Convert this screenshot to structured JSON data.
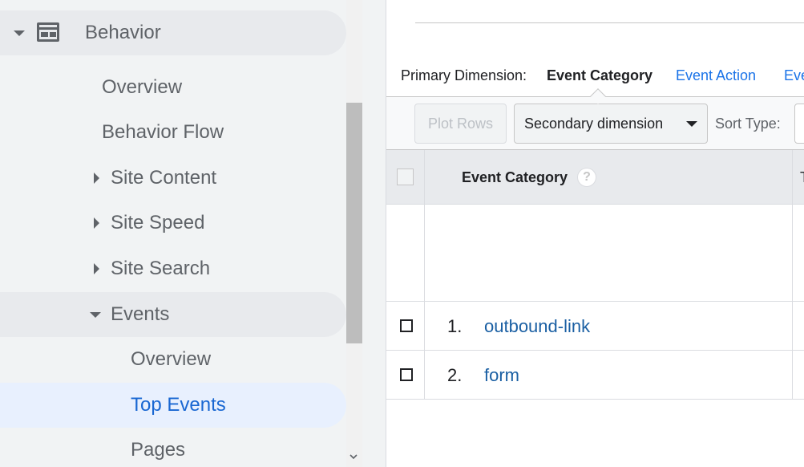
{
  "sidebar": {
    "behavior": {
      "label": "Behavior",
      "icon": "behavior-icon"
    },
    "items": [
      {
        "label": "Overview"
      },
      {
        "label": "Behavior Flow"
      },
      {
        "label": "Site Content"
      },
      {
        "label": "Site Speed"
      },
      {
        "label": "Site Search"
      },
      {
        "label": "Events"
      },
      {
        "label": "Overview"
      },
      {
        "label": "Top Events"
      },
      {
        "label": "Pages"
      }
    ]
  },
  "dimensions": {
    "primary_label": "Primary Dimension:",
    "selected": "Event Category",
    "options": [
      "Event Action",
      "Eve"
    ]
  },
  "toolbar": {
    "plot_rows": "Plot Rows",
    "secondary_dimension": "Secondary dimension",
    "sort_type": "Sort Type:"
  },
  "table": {
    "header": "Event Category",
    "help_icon": "?",
    "next_col": "T",
    "rows": [
      {
        "index": "1.",
        "category": "outbound-link"
      },
      {
        "index": "2.",
        "category": "form"
      }
    ]
  },
  "colors": {
    "link": "#1a5fa3",
    "accent": "#1a73e8",
    "selected_bg": "#e8f0fe",
    "selected_text": "#1967d2"
  }
}
